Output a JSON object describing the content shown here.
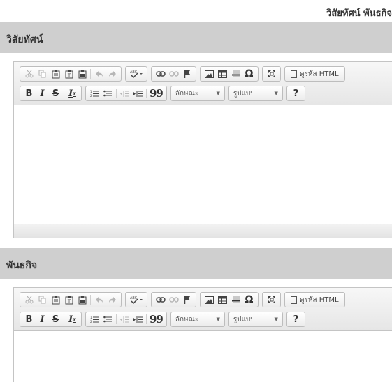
{
  "page": {
    "title": "วิสัยทัศน์ พันธกิจ"
  },
  "sections": {
    "vision": {
      "heading": "วิสัยทัศน์"
    },
    "mission": {
      "heading": "พันธกิจ"
    }
  },
  "toolbar": {
    "source_label": "ดูรหัส HTML",
    "style_combo_label": "ลักษณะ",
    "format_combo_label": "รูปแบบ",
    "help_label": "?",
    "bold_label": "B",
    "italic_label": "I",
    "strike_label": "S",
    "remove_format_label": "I",
    "remove_format_sub": "x",
    "blockquote_label": "99",
    "special_char_label": "Ω",
    "dropdown_arrow": "▼",
    "icons": [
      "cut-icon",
      "copy-icon",
      "paste-icon",
      "paste-text-icon",
      "paste-word-icon",
      "undo-icon",
      "redo-icon",
      "spellcheck-icon",
      "link-icon",
      "unlink-icon",
      "anchor-icon",
      "image-icon",
      "table-icon",
      "horizontal-rule-icon",
      "special-char-icon",
      "maximize-icon",
      "source-icon",
      "numbered-list-icon",
      "bulleted-list-icon",
      "outdent-icon",
      "indent-icon",
      "blockquote-icon"
    ]
  },
  "colors": {
    "header_bg": "#cfcfcf",
    "toolbar_bg": "#ececec",
    "border": "#c4c4c4"
  }
}
